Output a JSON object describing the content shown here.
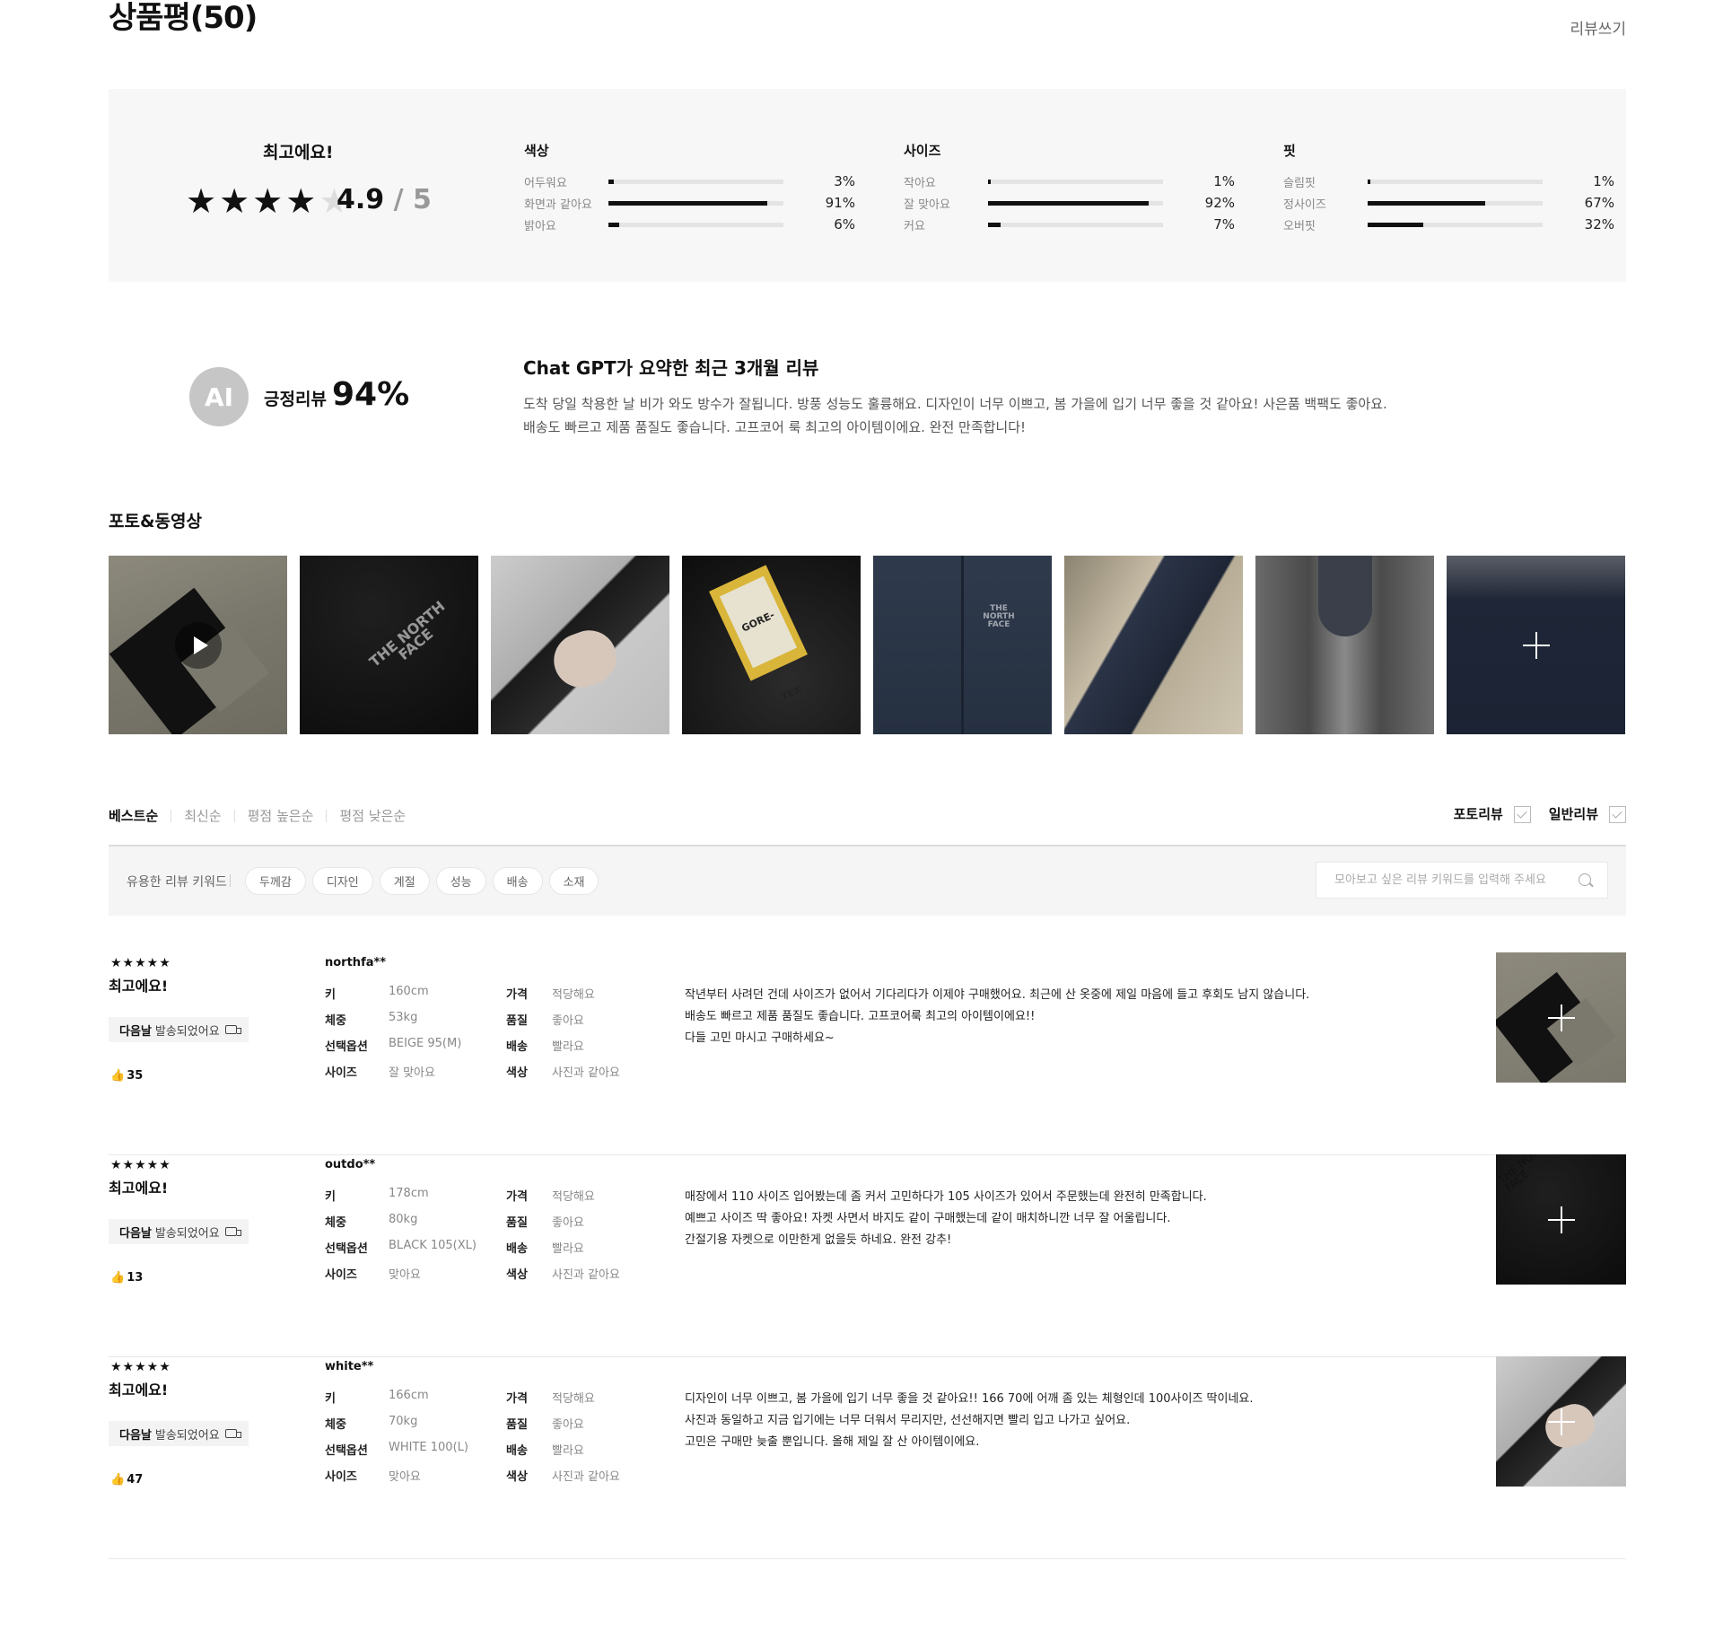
{
  "header": {
    "title": "상품평(50)",
    "write_review": "리뷰쓰기"
  },
  "summary": {
    "headline": "최고에요!",
    "rating": "4.9",
    "rating_total": "/ 5",
    "stars_filled": 4,
    "groups": [
      {
        "title": "색상",
        "rows": [
          {
            "label": "어두워요",
            "pct": 3,
            "pct_text": "3%"
          },
          {
            "label": "화면과 같아요",
            "pct": 91,
            "pct_text": "91%"
          },
          {
            "label": "밝아요",
            "pct": 6,
            "pct_text": "6%"
          }
        ]
      },
      {
        "title": "사이즈",
        "rows": [
          {
            "label": "작아요",
            "pct": 1,
            "pct_text": "1%"
          },
          {
            "label": "잘 맞아요",
            "pct": 92,
            "pct_text": "92%"
          },
          {
            "label": "커요",
            "pct": 7,
            "pct_text": "7%"
          }
        ]
      },
      {
        "title": "핏",
        "rows": [
          {
            "label": "슬림핏",
            "pct": 1,
            "pct_text": "1%"
          },
          {
            "label": "정사이즈",
            "pct": 67,
            "pct_text": "67%"
          },
          {
            "label": "오버핏",
            "pct": 32,
            "pct_text": "32%"
          }
        ]
      }
    ]
  },
  "ai": {
    "badge": "AI",
    "label": "긍정리뷰",
    "percent": "94%",
    "summary_title": "Chat GPT가 요약한 최근 3개월 리뷰",
    "summary_line1": "도착 당일 착용한 날 비가 와도 방수가 잘됩니다. 방풍 성능도 훌륭해요. 디자인이 너무 이쁘고, 봄 가을에 입기 너무 좋을 것 같아요! 사은품 백팩도 좋아요.",
    "summary_line2": "배송도 빠르고 제품 품질도 좋습니다. 고프코어 룩 최고의 아이템이에요. 완전 만족합니다!"
  },
  "photos": {
    "title": "포토&동영상",
    "logo_text": "THE NORTH FACE",
    "gore_text": "GORE-TEX"
  },
  "sort": {
    "options": [
      "베스트순",
      "최신순",
      "평점 높은순",
      "평점 낮은순"
    ],
    "photo_review": "포토리뷰",
    "general_review": "일반리뷰"
  },
  "keywords": {
    "label": "유용한 리뷰 키워드",
    "chips": [
      "두께감",
      "디자인",
      "계절",
      "성능",
      "배송",
      "소재"
    ],
    "search_placeholder": "모아보고 싶은 리뷰 키워드를 입력해 주세요"
  },
  "spec_labels": {
    "height": "키",
    "weight": "체중",
    "option": "선택옵션",
    "size": "사이즈",
    "price": "가격",
    "quality": "품질",
    "delivery": "배송",
    "color": "색상"
  },
  "reviews": [
    {
      "stars": "★★★★★",
      "headline": "최고에요!",
      "ship_bold": "다음날",
      "ship_rest": "발송되었어요",
      "likes": "35",
      "user": "northfa**",
      "height": "160cm",
      "weight": "53kg",
      "option": "BEIGE 95(M)",
      "size": "잘 맞아요",
      "price": "적당해요",
      "quality": "좋아요",
      "delivery": "빨라요",
      "color": "사진과 같아요",
      "line1": "작년부터 사려던 건데 사이즈가 없어서 기다리다가 이제야 구매했어요. 최근에 산 옷중에 제일 마음에 들고 후회도 남지 않습니다.",
      "line2": "배송도 빠르고 제품 품질도 좋습니다. 고프코어룩 최고의 아이템이에요!!",
      "line3": "다들 고민 마시고 구매하세요~"
    },
    {
      "stars": "★★★★★",
      "headline": "최고에요!",
      "ship_bold": "다음날",
      "ship_rest": "발송되었어요",
      "likes": "13",
      "user": "outdo**",
      "height": "178cm",
      "weight": "80kg",
      "option": "BLACK 105(XL)",
      "size": "맞아요",
      "price": "적당해요",
      "quality": "좋아요",
      "delivery": "빨라요",
      "color": "사진과 같아요",
      "line1": "매장에서 110 사이즈 입어봤는데 좀 커서 고민하다가 105 사이즈가 있어서 주문했는데 완전히 만족합니다.",
      "line2": "예쁘고 사이즈 딱 좋아요! 자켓 사면서 바지도 같이 구매했는데 같이 매치하니깐 너무 잘 어울립니다.",
      "line3": "간절기용 자켓으로 이만한게 없을듯 하네요. 완전 강추!"
    },
    {
      "stars": "★★★★★",
      "headline": "최고에요!",
      "ship_bold": "다음날",
      "ship_rest": "발송되었어요",
      "likes": "47",
      "user": "white**",
      "height": "166cm",
      "weight": "70kg",
      "option": "WHITE 100(L)",
      "size": "맞아요",
      "price": "적당해요",
      "quality": "좋아요",
      "delivery": "빨라요",
      "color": "사진과 같아요",
      "line1": "디자인이 너무 이쁘고, 봄 가을에 입기 너무 좋을 것 같아요!! 166 70에 어깨 좀 있는 체형인데 100사이즈 딱이네요.",
      "line2": "사진과 동일하고 지금 입기에는 너무 더워서 무리지만, 선선해지면 빨리 입고 나가고 싶어요.",
      "line3": "고민은 구매만 늦출 뿐입니다. 올해 제일 잘 산 아이템이에요."
    }
  ]
}
